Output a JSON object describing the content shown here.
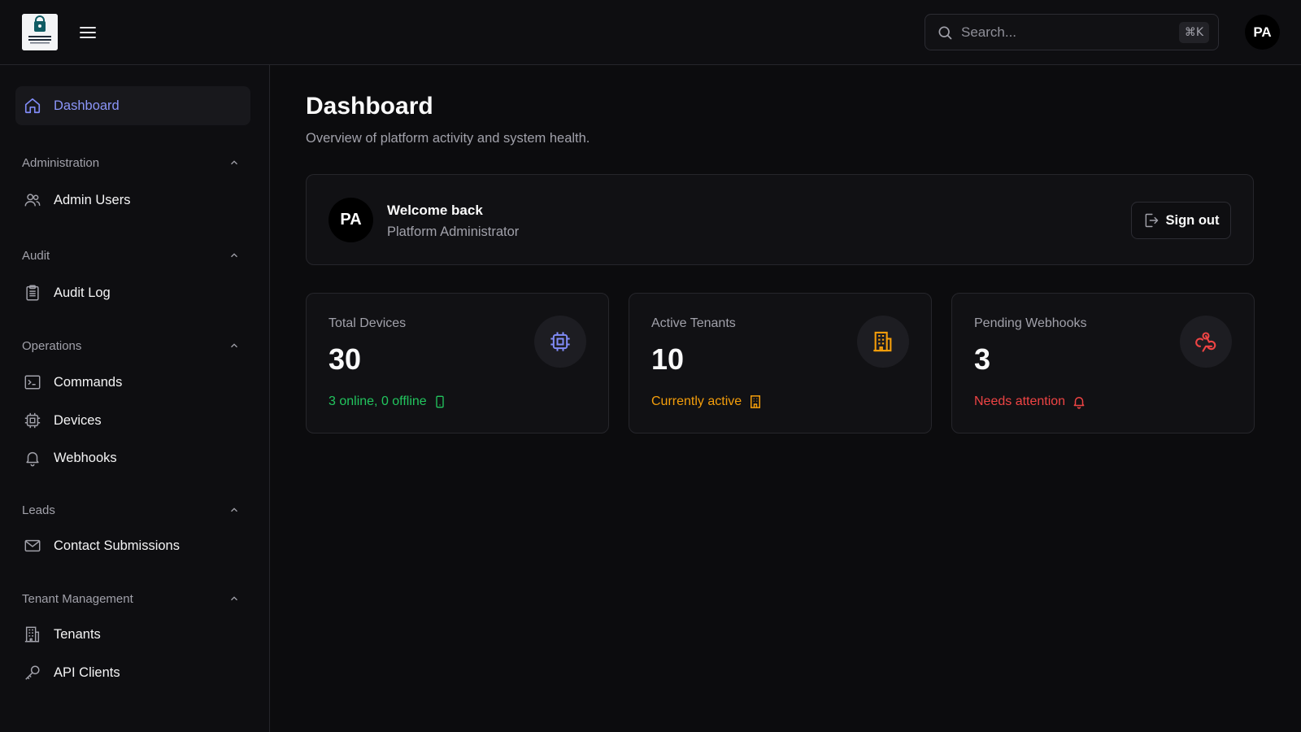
{
  "topbar": {
    "search": {
      "placeholder": "Search...",
      "shortcut": "⌘K"
    },
    "avatar_initials": "PA"
  },
  "sidebar": {
    "dashboard": {
      "label": "Dashboard",
      "icon": "home-icon"
    },
    "sections": [
      {
        "title": "Administration",
        "items": [
          {
            "label": "Admin Users",
            "icon": "users-icon"
          }
        ]
      },
      {
        "title": "Audit",
        "items": [
          {
            "label": "Audit Log",
            "icon": "clipboard-icon"
          }
        ]
      },
      {
        "title": "Operations",
        "items": [
          {
            "label": "Commands",
            "icon": "terminal-icon"
          },
          {
            "label": "Devices",
            "icon": "cpu-icon"
          },
          {
            "label": "Webhooks",
            "icon": "bell-icon"
          }
        ]
      },
      {
        "title": "Leads",
        "items": [
          {
            "label": "Contact Submissions",
            "icon": "mail-icon"
          }
        ]
      },
      {
        "title": "Tenant Management",
        "items": [
          {
            "label": "Tenants",
            "icon": "building-icon"
          },
          {
            "label": "API Clients",
            "icon": "key-icon"
          }
        ]
      }
    ]
  },
  "main": {
    "title": "Dashboard",
    "subtitle": "Overview of platform activity and system health.",
    "welcome": {
      "initials": "PA",
      "title": "Welcome back",
      "subtitle": "Platform Administrator",
      "signout_label": "Sign out"
    },
    "cards": [
      {
        "label": "Total Devices",
        "value": "30",
        "note": "3 online, 0 offline",
        "note_color": "#22c55e",
        "icon": "cpu-icon",
        "icon_color": "#818cf8",
        "note_icon": "smartphone-icon"
      },
      {
        "label": "Active Tenants",
        "value": "10",
        "note": "Currently active",
        "note_color": "#f59e0b",
        "icon": "building-icon",
        "icon_color": "#f59e0b",
        "note_icon": "building-icon"
      },
      {
        "label": "Pending Webhooks",
        "value": "3",
        "note": "Needs attention",
        "note_color": "#ef4444",
        "icon": "webhook-icon",
        "icon_color": "#ef4444",
        "note_icon": "bell-icon"
      }
    ]
  },
  "colors": {
    "accent": "#818cf8",
    "background": "#0c0c0e",
    "surface": "#111114",
    "border": "#26262b"
  }
}
